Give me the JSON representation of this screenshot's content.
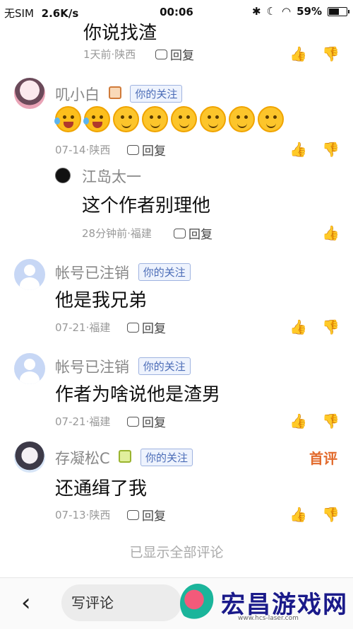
{
  "status_bar": {
    "carrier": "无SIM",
    "speed": "2.6K/s",
    "time": "00:06",
    "battery": "59%"
  },
  "comments": [
    {
      "content": "你说找渣",
      "meta": "1天前·陕西",
      "reply_label": "回复"
    },
    {
      "name": "叽小白",
      "badge": "你的关注",
      "emoji_count": 8,
      "meta": "07-14·陕西",
      "reply_label": "回复"
    },
    {
      "name": "江岛太一",
      "content": "这个作者别理他",
      "meta": "28分钟前·福建",
      "reply_label": "回复"
    },
    {
      "name": "帐号已注销",
      "badge": "你的关注",
      "content": "他是我兄弟",
      "meta": "07-21·福建",
      "reply_label": "回复"
    },
    {
      "name": "帐号已注销",
      "badge": "你的关注",
      "content": "作者为啥说他是渣男",
      "meta": "07-21·福建",
      "reply_label": "回复"
    },
    {
      "name": "存凝松C",
      "badge": "你的关注",
      "first_tag": "首评",
      "content": "还通缉了我",
      "meta": "07-13·陕西",
      "reply_label": "回复"
    }
  ],
  "footer_note": "已显示全部评论",
  "bottom_bar": {
    "comment_placeholder": "写评论",
    "watermark_text": "宏昌游戏网",
    "watermark_url": "www.hcs-laser.com"
  }
}
